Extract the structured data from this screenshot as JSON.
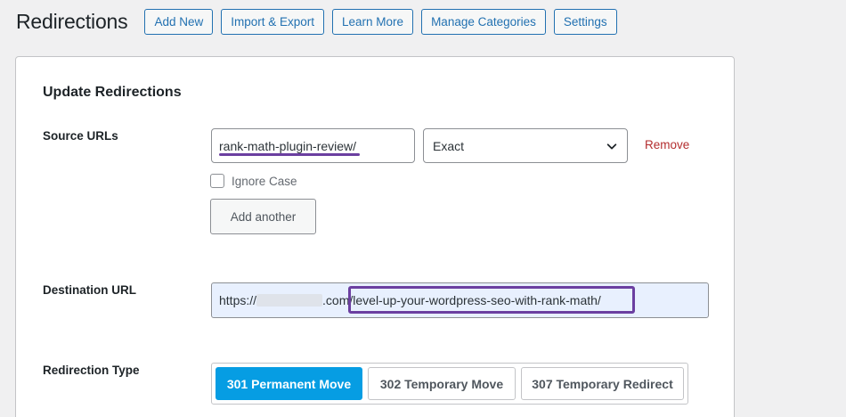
{
  "header": {
    "title": "Redirections",
    "buttons": [
      "Add New",
      "Import & Export",
      "Learn More",
      "Manage Categories",
      "Settings"
    ]
  },
  "card": {
    "title": "Update Redirections",
    "source": {
      "label": "Source URLs",
      "value": "rank-math-plugin-review/",
      "match_selected": "Exact",
      "remove_label": "Remove",
      "ignore_case_label": "Ignore Case",
      "ignore_case_checked": false,
      "add_another_label": "Add another"
    },
    "destination": {
      "label": "Destination URL",
      "prefix": "https://",
      "domain_suffix": ".com",
      "path": "/level-up-your-wordpress-seo-with-rank-math/"
    },
    "redirection_type": {
      "label": "Redirection Type",
      "options": [
        "301 Permanent Move",
        "302 Temporary Move",
        "307 Temporary Redirect"
      ],
      "selected": "301 Permanent Move"
    }
  },
  "colors": {
    "accent": "#2271b1",
    "active_type": "#069de3",
    "highlight": "#6b3fa0",
    "remove": "#b32d2e"
  }
}
